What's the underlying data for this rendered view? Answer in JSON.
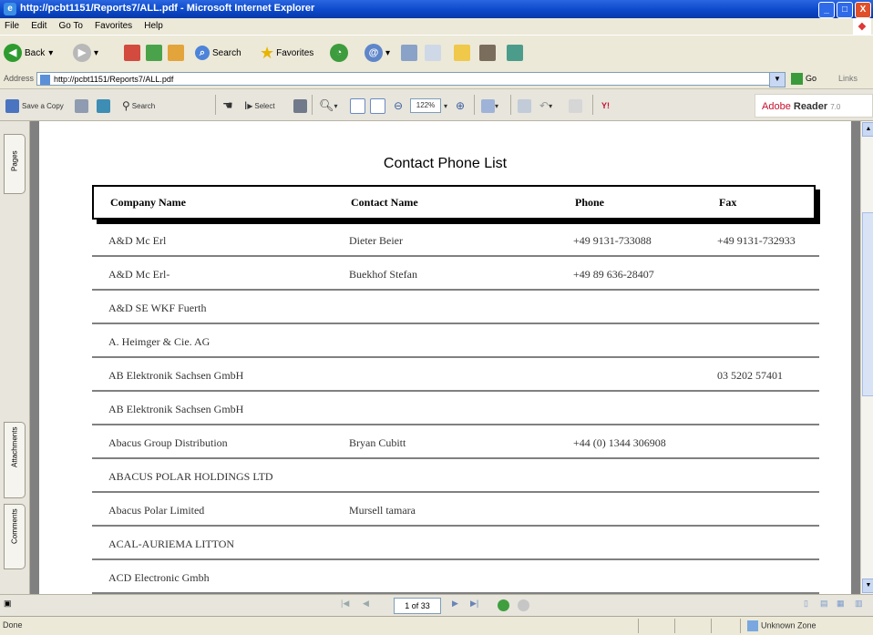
{
  "window": {
    "title": "http://pcbt1151/Reports7/ALL.pdf - Microsoft Internet Explorer",
    "controls": [
      "_",
      "□",
      "X"
    ]
  },
  "menubar": {
    "items": [
      "File",
      "Edit",
      "Go To",
      "Favorites",
      "Help"
    ]
  },
  "toolbar": {
    "back": "Back",
    "search": "Search",
    "favorites": "Favorites"
  },
  "address": {
    "label": "Address",
    "value": "http://pcbt1151/Reports7/ALL.pdf",
    "go": "Go",
    "links": "Links"
  },
  "reader_toolbar": {
    "save_copy": "Save a Copy",
    "search": "Search",
    "select": "Select",
    "zoom": "122%",
    "brand": {
      "adobe": "Adobe",
      "reader": "Reader",
      "version": "7.0"
    }
  },
  "sidebar": {
    "tabs": [
      "Pages",
      "Attachments",
      "Comments"
    ]
  },
  "document": {
    "title": "Contact Phone List",
    "columns": [
      "Company Name",
      "Contact Name",
      "Phone",
      "Fax"
    ],
    "rows": [
      [
        "A&D Mc Erl",
        "Dieter Beier",
        "+49 9131-733088",
        "+49 9131-732933"
      ],
      [
        "A&D Mc Erl-",
        "Buekhof Stefan",
        "+49 89 636-28407",
        ""
      ],
      [
        "A&D SE WKF Fuerth",
        "",
        "",
        ""
      ],
      [
        "A. Heimger & Cie. AG",
        "",
        "",
        ""
      ],
      [
        "AB Elektronik Sachsen GmbH",
        "",
        "",
        "03 5202 57401"
      ],
      [
        "AB Elektronik Sachsen GmbH",
        "",
        "",
        ""
      ],
      [
        "Abacus Group Distribution",
        "Bryan Cubitt",
        "+44 (0) 1344 306908",
        ""
      ],
      [
        "ABACUS POLAR HOLDINGS LTD",
        "",
        "",
        ""
      ],
      [
        "Abacus Polar Limited",
        "Mursell tamara",
        "",
        ""
      ],
      [
        "ACAL-AURIEMA LITTON",
        "",
        "",
        ""
      ],
      [
        "ACD Electronic Gmbh",
        "",
        "",
        ""
      ]
    ]
  },
  "navigation": {
    "page_indicator": "1 of 33"
  },
  "status": {
    "left": "Done",
    "zone": "Unknown Zone"
  },
  "colors": {
    "title_bar": "#0a47c8",
    "adobe_red": "#c8102e",
    "row_rule": "#808080"
  }
}
